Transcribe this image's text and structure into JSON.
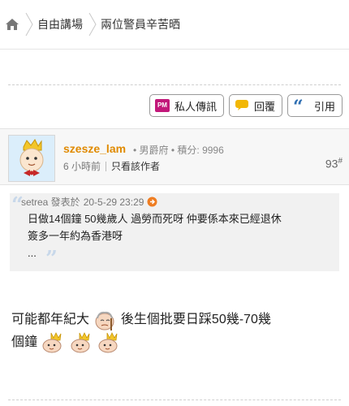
{
  "breadcrumb": {
    "home_icon": "home-icon",
    "items": [
      "自由講場",
      "兩位警員辛苦晒"
    ]
  },
  "actions": {
    "pm_badge": "PM",
    "pm_label": "私人傳訊",
    "reply_label": "回覆",
    "quote_label": "引用"
  },
  "post": {
    "username": "szesze_lam",
    "rank": "• 男爵府 • 積分: 9996",
    "time": "6 小時前",
    "only_author": "只看該作者",
    "floor_number": "93",
    "floor_suffix": "#",
    "quote": {
      "author": "setrea 發表於",
      "timestamp": "20-5-29 23:29",
      "text_line1": "日做14個鐘 50幾歲人 過勞而死呀 仲要係本來已經退休",
      "text_line2": "簽多一年約為香港呀",
      "text_line3": "..."
    },
    "content_part1": "可能都年紀大",
    "content_part2": " 後生個批要日踩50幾-70幾",
    "content_part3": "個鐘"
  },
  "colors": {
    "username": "#e08a00",
    "pm_icon_bg": "#c2187a",
    "reply_icon": "#f2b705",
    "quote_icon": "#2f6fb2",
    "goto_icon": "#ef7d22"
  }
}
